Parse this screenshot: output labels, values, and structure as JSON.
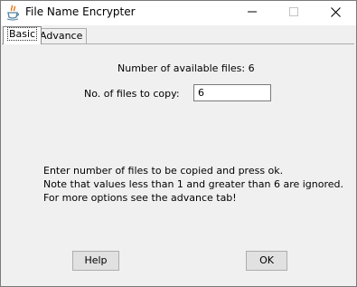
{
  "window": {
    "title": "File Name Encrypter"
  },
  "tabs": [
    {
      "label": "Basic",
      "active": true
    },
    {
      "label": "Advance",
      "active": false
    }
  ],
  "basic": {
    "available_label": "Number of available files: 6",
    "copy_label": "No. of files to copy:",
    "copy_value": "6",
    "notes": [
      "Enter number of files to be copied and press ok.",
      "Note that values less than 1 and greater than 6 are ignored.",
      "For more options see the advance tab!"
    ]
  },
  "buttons": {
    "help": "Help",
    "ok": "OK"
  },
  "colors": {
    "panel_bg": "#f0f0f0",
    "titlebar_bg": "#ffffff",
    "button_bg": "#e1e1e1"
  },
  "icons": {
    "app": "java-coffee-cup-icon",
    "minimize": "minimize-icon",
    "maximize": "maximize-icon",
    "close": "close-icon"
  }
}
